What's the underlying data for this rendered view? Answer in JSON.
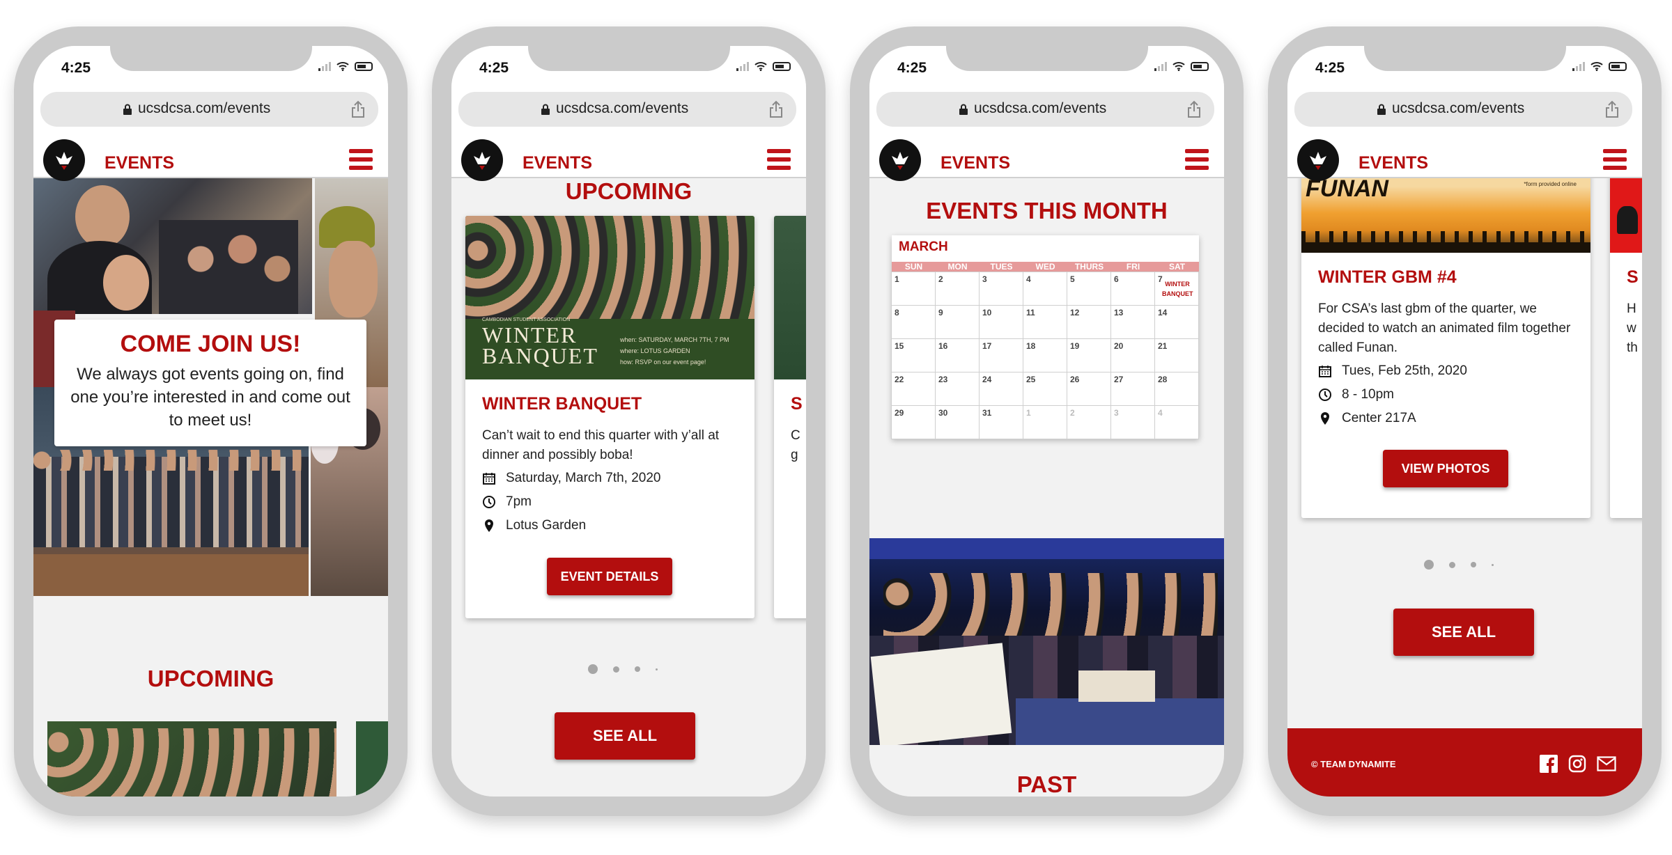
{
  "status": {
    "time": "4:25"
  },
  "browser": {
    "url": "ucsdcsa.com/events"
  },
  "site": {
    "section_title": "EVENTS"
  },
  "screen1": {
    "join_title": "COME JOIN US!",
    "join_text": "We always got events going on, find one you’re interested in and come out to meet us!",
    "upcoming_heading": "UPCOMING"
  },
  "screen2": {
    "upcoming_heading": "UPCOMING",
    "poster": {
      "small_caption": "CAMBODIAN STUDENT ASSOCIATION",
      "title_line1": "WINTER",
      "title_line2": "BANQUET",
      "when": "when: SATURDAY, MARCH 7TH, 7 PM",
      "where": "where: LOTUS GARDEN",
      "how": "how: RSVP on our event page!"
    },
    "card": {
      "title": "WINTER BANQUET",
      "description": "Can’t wait to end this quarter with y’all at dinner and possibly boba!",
      "date": "Saturday, March 7th, 2020",
      "time": "7pm",
      "location": "Lotus Garden",
      "button": "EVENT DETAILS"
    },
    "peek": {
      "title_letter": "S",
      "desc_letter1": "C",
      "desc_letter2": "g"
    },
    "see_all": "SEE ALL"
  },
  "screen3": {
    "heading": "EVENTS THIS MONTH",
    "calendar": {
      "month": "MARCH",
      "days": [
        "SUN",
        "MON",
        "TUES",
        "WED",
        "THURS",
        "FRI",
        "SAT"
      ],
      "cells": [
        "1",
        "2",
        "3",
        "4",
        "5",
        "6",
        "7",
        "8",
        "9",
        "10",
        "11",
        "12",
        "13",
        "14",
        "15",
        "16",
        "17",
        "18",
        "19",
        "20",
        "21",
        "22",
        "23",
        "24",
        "25",
        "26",
        "27",
        "28",
        "29",
        "30",
        "31",
        "1",
        "2",
        "3",
        "4"
      ],
      "event_line1": "WINTER",
      "event_line2": "BANQUET"
    },
    "past_heading": "PAST"
  },
  "screen4": {
    "poster_title": "FUNAN",
    "poster_note": "*form provided online",
    "card": {
      "title": "WINTER GBM #4",
      "description": "For CSA’s last gbm of the quarter, we decided to watch an animated film together called Funan.",
      "date": "Tues, Feb 25th, 2020",
      "time": "8 - 10pm",
      "location": "Center 217A",
      "button": "VIEW PHOTOS"
    },
    "peek": {
      "title_letter": "S",
      "desc_letter1": "H",
      "desc_letter2": "w",
      "desc_letter3": "th"
    },
    "see_all": "SEE ALL",
    "footer_credit": "© TEAM DYNAMITE"
  },
  "colors": {
    "brand_red": "#b30e0e",
    "frame_gray": "#cbcbcb",
    "page_bg": "#f2f2f2",
    "poster_green": "#2f4d24",
    "sunset_orange": "#f0a030"
  }
}
